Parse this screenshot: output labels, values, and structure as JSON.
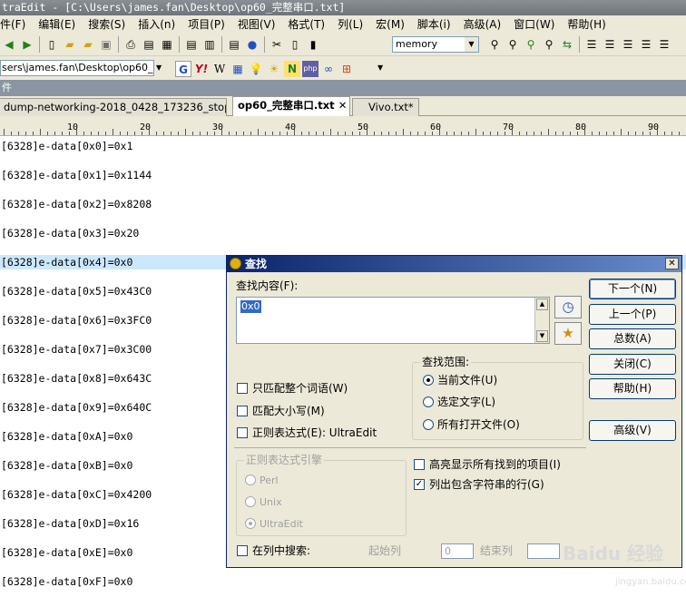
{
  "window": {
    "title": "traEdit - [C:\\Users\\james.fan\\Desktop\\op60_完整串口.txt]"
  },
  "menu": [
    {
      "label": "件(F)"
    },
    {
      "label": "编辑(E)"
    },
    {
      "label": "搜索(S)"
    },
    {
      "label": "插入(n)"
    },
    {
      "label": "项目(P)"
    },
    {
      "label": "视图(V)"
    },
    {
      "label": "格式(T)"
    },
    {
      "label": "列(L)"
    },
    {
      "label": "宏(M)"
    },
    {
      "label": "脚本(i)"
    },
    {
      "label": "高级(A)"
    },
    {
      "label": "窗口(W)"
    },
    {
      "label": "帮助(H)"
    }
  ],
  "toolbar": {
    "combo_value": "memory",
    "path_value": "sers\\james.fan\\Desktop\\op60_"
  },
  "panel": {
    "header": "件"
  },
  "tabs": [
    {
      "label": "dump-networking-2018_0428_173236_stop.txt"
    },
    {
      "label": "op60_完整串口.txt",
      "close": "✕"
    },
    {
      "label": "Vivo.txt*"
    }
  ],
  "ruler": {
    "labels": [
      "10",
      "20",
      "30",
      "40",
      "50",
      "60",
      "70",
      "80",
      "90"
    ]
  },
  "lines": [
    "[6328]e-data[0x0]=0x1",
    "[6328]e-data[0x1]=0x1144",
    "[6328]e-data[0x2]=0x8208",
    "[6328]e-data[0x3]=0x20",
    "[6328]e-data[0x4]=0x0",
    "[6328]e-data[0x5]=0x43C0",
    "[6328]e-data[0x6]=0x3FC0",
    "[6328]e-data[0x7]=0x3C00",
    "[6328]e-data[0x8]=0x643C",
    "[6328]e-data[0x9]=0x640C",
    "[6328]e-data[0xA]=0x0",
    "[6328]e-data[0xB]=0x0",
    "[6328]e-data[0xC]=0x4200",
    "[6328]e-data[0xD]=0x16",
    "[6328]e-data[0xE]=0x0",
    "[6328]e-data[0xF]=0x0"
  ],
  "dialog": {
    "title": "查找",
    "find_label": "查找内容(F):",
    "find_value": "0x0",
    "buttons": {
      "next": "下一个(N)",
      "prev": "上一个(P)",
      "count": "总数(A)",
      "close": "关闭(C)",
      "help": "帮助(H)",
      "advanced": "高级(V)"
    },
    "options": {
      "whole_word": "只匹配整个词语(W)",
      "match_case": "匹配大小写(M)",
      "regex": "正则表达式(E): UltraEdit"
    },
    "scope": {
      "title": "查找范围:",
      "current": "当前文件(U)",
      "selection": "选定文字(L)",
      "all_open": "所有打开文件(O)"
    },
    "regex_engine": {
      "title": "正则表达式引擎",
      "perl": "Perl",
      "unix": "Unix",
      "ultraedit": "UltraEdit"
    },
    "highlight_all": "高亮显示所有找到的项目(I)",
    "list_lines": "列出包含字符串的行(G)",
    "column_search": "在列中搜索:",
    "start_col": "起始列",
    "start_val": "0",
    "end_col": "结束列"
  },
  "watermark": {
    "main": "Baidu 经验",
    "sub": "jingyan.baidu.com"
  }
}
